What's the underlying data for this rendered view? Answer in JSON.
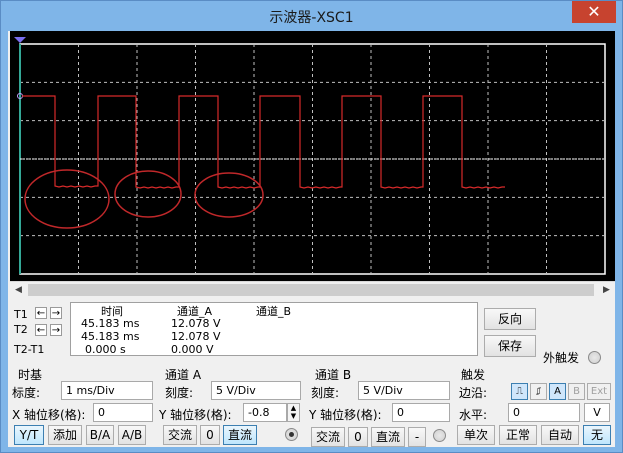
{
  "window": {
    "title": "示波器-XSC1",
    "close_symbol": "✕"
  },
  "colors": {
    "trace": "#d62a2a",
    "grid": "#ffffff",
    "screen": "#000000",
    "window_frame": "#7fb5e8"
  },
  "cursors": {
    "t1_label": "T1",
    "t2_label": "T2",
    "diff_label": "T2-T1"
  },
  "readout": {
    "headers": {
      "time": "时间",
      "channel_a": "通道_A",
      "channel_b": "通道_B"
    },
    "rows": [
      {
        "time": "45.183 ms",
        "channel_a": "12.078 V"
      },
      {
        "time": "45.183 ms",
        "channel_a": "12.078 V"
      },
      {
        "time": "0.000 s",
        "channel_a": "0.000 V"
      }
    ]
  },
  "buttons": {
    "reverse": "反向",
    "save": "保存"
  },
  "external_trigger_label": "外触发",
  "timebase": {
    "title": "时基",
    "scale_label": "标度:",
    "scale_value": "1 ms/Div",
    "xpos_label": "X 轴位移(格):",
    "xpos_value": "0",
    "modes": [
      "Y/T",
      "添加",
      "B/A",
      "A/B"
    ]
  },
  "channel_a": {
    "title": "通道 A",
    "scale_label": "刻度:",
    "scale_value": "5  V/Div",
    "ypos_label": "Y 轴位移(格):",
    "ypos_value": "-0.8",
    "coupling": [
      "交流",
      "0",
      "直流"
    ]
  },
  "channel_b": {
    "title": "通道 B",
    "scale_label": "刻度:",
    "scale_value": "5  V/Div",
    "ypos_label": "Y 轴位移(格):",
    "ypos_value": "0",
    "coupling": [
      "交流",
      "0",
      "直流",
      "-"
    ]
  },
  "trigger": {
    "title": "触发",
    "edge_label": "边沿:",
    "edge_buttons": [
      "A",
      "B",
      "Ext"
    ],
    "level_label": "水平:",
    "level_value": "0",
    "level_unit": "V",
    "modes": [
      "单次",
      "正常",
      "自动",
      "无"
    ]
  }
}
